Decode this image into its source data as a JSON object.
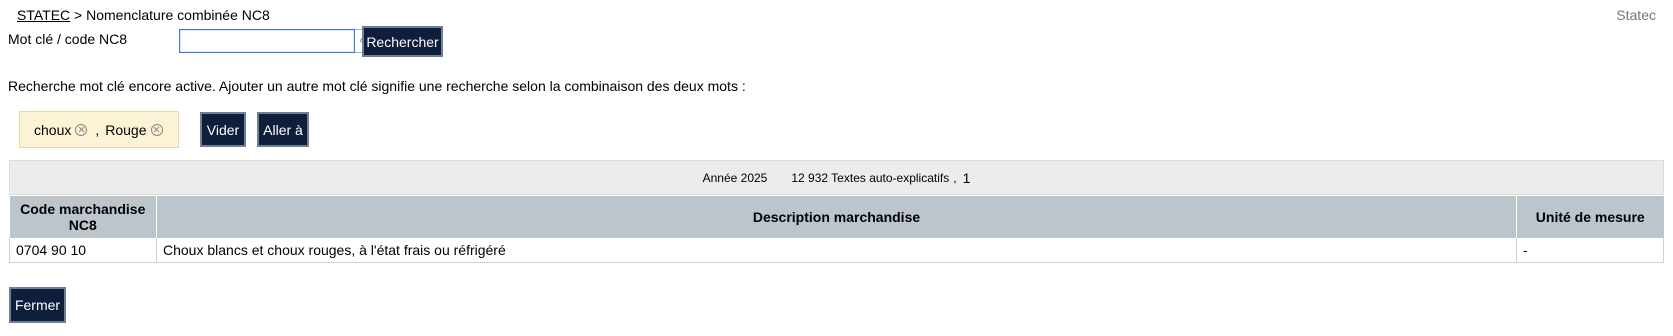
{
  "header": {
    "breadcrumb_link": "STATEC",
    "breadcrumb_separator": ">",
    "breadcrumb_current": "Nomenclature combinée NC8",
    "brand": "Statec"
  },
  "search": {
    "label": "Mot clé / code NC8",
    "value": "",
    "placeholder": "",
    "addon_icon": "enter-icon",
    "submit_label": "Rechercher"
  },
  "notice": "Recherche mot clé encore active. Ajouter un autre mot clé signifie une recherche selon la combinaison des deux mots :",
  "keywords": {
    "items": [
      "choux",
      "Rouge"
    ],
    "separator": ",",
    "remove_icon": "remove-circle-icon",
    "clear_label": "Vider",
    "goto_label": "Aller à"
  },
  "info": {
    "year": "Année 2025",
    "texts": "12 932 Textes auto-explicatifs",
    "separator": ",",
    "page": "1"
  },
  "table": {
    "headers": [
      "Code marchandise NC8",
      "Description marchandise",
      "Unité de mesure"
    ],
    "rows": [
      [
        "0704 90 10",
        "Choux blancs et choux rouges, à l'état frais ou réfrigéré",
        "-"
      ]
    ]
  },
  "footer": {
    "close_label": "Fermer"
  },
  "colors": {
    "button_bg": "#0f1e3a",
    "tag_bg": "#fcf2d6",
    "header_bg": "#bcc4cc",
    "info_bg": "#ececec",
    "input_border": "#3a7bd5"
  }
}
